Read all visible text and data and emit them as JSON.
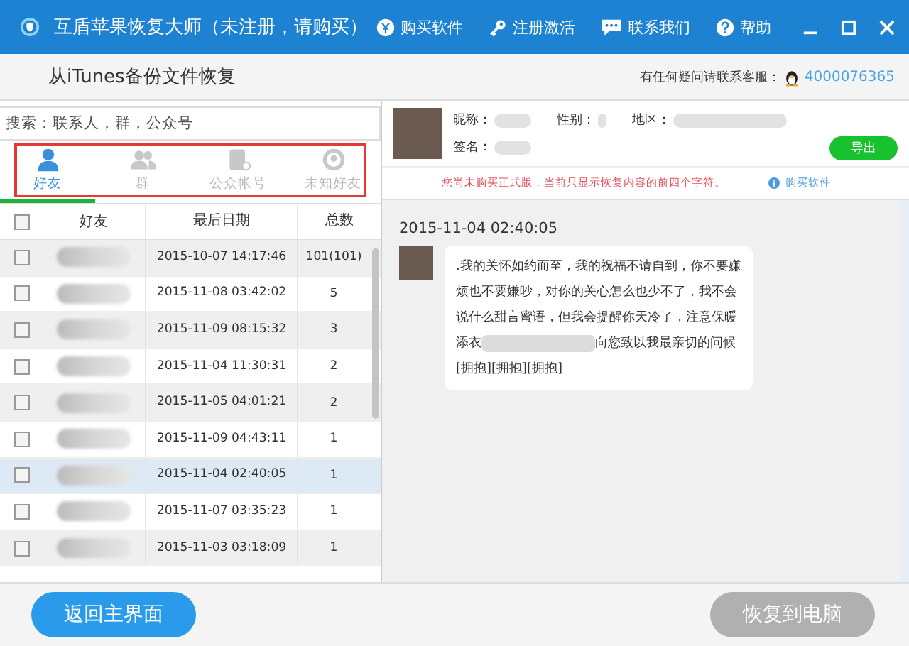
{
  "window": {
    "title": "互盾苹果恢复大师（未注册，请购买）",
    "menu": [
      {
        "kind": "yuan",
        "label": "购买软件"
      },
      {
        "kind": "key",
        "label": "注册激活"
      },
      {
        "kind": "chat",
        "label": "联系我们"
      },
      {
        "kind": "help",
        "label": "帮助"
      }
    ]
  },
  "header": {
    "title": "从iTunes备份文件恢复",
    "support_label": "有任何疑问请联系客服：",
    "support_number": "4000076365"
  },
  "search": {
    "placeholder": "搜索：联系人，群，公众号"
  },
  "tabs": [
    {
      "kind": "friend",
      "label": "好友",
      "selected": true
    },
    {
      "kind": "group",
      "label": "群",
      "selected": false
    },
    {
      "kind": "official",
      "label": "公众帐号",
      "selected": false
    },
    {
      "kind": "unknown",
      "label": "未知好友",
      "selected": false
    }
  ],
  "table": {
    "select_all_checked": false,
    "columns": [
      "好友",
      "最后日期",
      "总数"
    ],
    "rows": [
      {
        "date": "2015-10-07 14:17:46",
        "count": "101(101)",
        "checked": false,
        "selected": false
      },
      {
        "date": "2015-11-08 03:42:02",
        "count": "5",
        "checked": false,
        "selected": false
      },
      {
        "date": "2015-11-09 08:15:32",
        "count": "3",
        "checked": false,
        "selected": false
      },
      {
        "date": "2015-11-04 11:30:31",
        "count": "2",
        "checked": false,
        "selected": false
      },
      {
        "date": "2015-11-05 04:01:21",
        "count": "2",
        "checked": false,
        "selected": false
      },
      {
        "date": "2015-11-09 04:43:11",
        "count": "1",
        "checked": false,
        "selected": false
      },
      {
        "date": "2015-11-04 02:40:05",
        "count": "1",
        "checked": false,
        "selected": true
      },
      {
        "date": "2015-11-07 03:35:23",
        "count": "1",
        "checked": false,
        "selected": false
      },
      {
        "date": "2015-11-03 03:18:09",
        "count": "1",
        "checked": false,
        "selected": false
      }
    ]
  },
  "profile": {
    "fields": [
      "昵称：",
      "性别：",
      "地区：",
      "签名："
    ],
    "export_button": "导出",
    "notice": "您尚未购买正式版，当前只显示恢复内容的前四个字符。",
    "buy_link": "购买软件"
  },
  "chat": {
    "timestamp": "2015-11-04 02:40:05",
    "lines": [
      {
        "kind": "text",
        "text": ".我的关怀如约而至，我的祝福不请自到，你不要嫌"
      },
      {
        "kind": "text",
        "text": "烦也不要嫌吵，对你的关心怎么也少不了，我不会"
      },
      {
        "kind": "text",
        "text": "说什么甜言蜜语，但我会提醒你天冷了，注意保暖"
      },
      {
        "kind": "redacted",
        "before": "添衣",
        "after": "向您致以我最亲切的问候"
      },
      {
        "kind": "text",
        "text": "[拥抱][拥抱][拥抱]"
      }
    ]
  },
  "footer": {
    "back_button": "返回主界面",
    "restore_button": "恢复到电脑"
  }
}
